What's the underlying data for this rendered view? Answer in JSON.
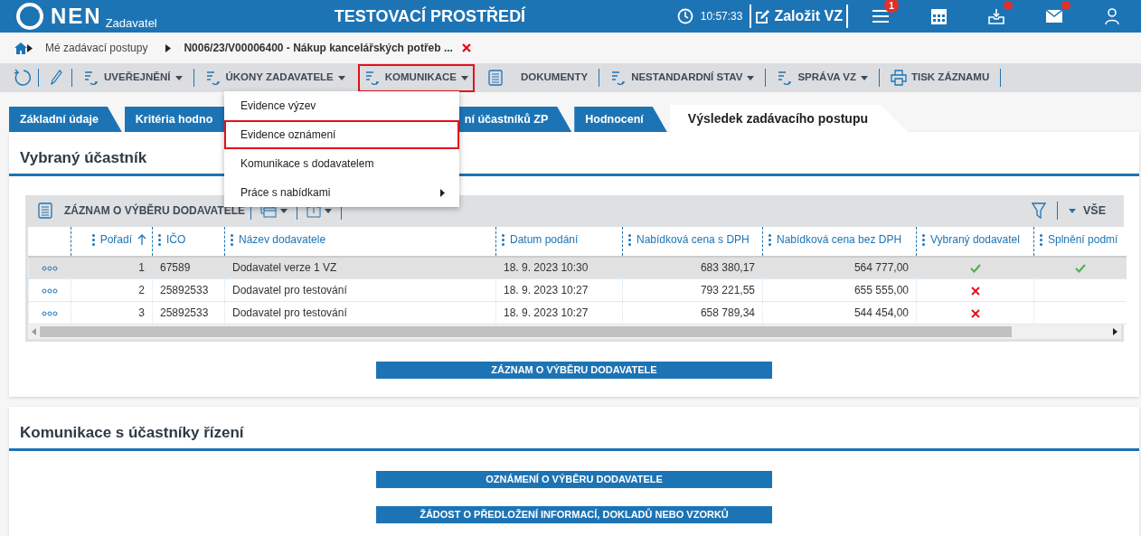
{
  "header": {
    "logo": "NEN",
    "subtitle": "Zadavatel",
    "title": "TESTOVACÍ PROSTŘEDÍ",
    "time": "10:57:33",
    "create_button": "Založit VZ",
    "notifications_badge": "1",
    "inbox_dot": true,
    "mail_dot": true
  },
  "breadcrumb": [
    {
      "kind": "link",
      "label": "Mé zadávací postupy"
    },
    {
      "kind": "current",
      "label": "N006/23/V00006400 - Nákup kancelářských potřeb ..."
    }
  ],
  "toolbar": [
    {
      "kind": "flow",
      "label": "UVEŘEJNĚNÍ",
      "dropdown": true,
      "highlighted": false
    },
    {
      "kind": "flow",
      "label": "ÚKONY ZADAVATELE",
      "dropdown": true,
      "highlighted": false
    },
    {
      "kind": "flow",
      "label": "KOMUNIKACE",
      "dropdown": true,
      "highlighted": true
    },
    {
      "kind": "document",
      "label": "DOKUMENTY",
      "dropdown": false,
      "highlighted": false
    },
    {
      "kind": "flow",
      "label": "NESTANDARDNÍ STAV",
      "dropdown": true,
      "highlighted": false
    },
    {
      "kind": "flow",
      "label": "SPRÁVA VZ",
      "dropdown": true,
      "highlighted": false
    },
    {
      "kind": "print",
      "label": "TISK ZÁZNAMU",
      "dropdown": false,
      "highlighted": false
    }
  ],
  "tabs": [
    {
      "label": "Základní údaje",
      "selected": false
    },
    {
      "label": "Kritéria hodno",
      "selected": false
    },
    {
      "label": "ní účastníků ZP",
      "selected": false
    },
    {
      "label": "Hodnocení",
      "selected": false
    },
    {
      "label": "Výsledek zadávacího postupu",
      "selected": true
    }
  ],
  "menu": {
    "items": [
      {
        "label": "Evidence výzev",
        "selected": false,
        "submenu": false
      },
      {
        "label": "Evidence oznámení",
        "selected": true,
        "submenu": false
      },
      {
        "label": "Komunikace s dodavatelem",
        "selected": false,
        "submenu": false
      },
      {
        "label": "Práce s nabídkami",
        "selected": false,
        "submenu": true
      }
    ]
  },
  "sections": [
    {
      "title": "Vybraný účastník",
      "grid": {
        "title": "ZÁZNAM O VÝBĚRU DODAVATELE",
        "filter_label": "VŠE",
        "columns": [
          {
            "label": "Pořadí",
            "kind": "number",
            "sorted": true
          },
          {
            "label": "IČO",
            "kind": "text",
            "sorted": false
          },
          {
            "label": "Název dodavatele",
            "kind": "text",
            "sorted": false
          },
          {
            "label": "Datum podání",
            "kind": "text",
            "sorted": false
          },
          {
            "label": "Nabídková cena s DPH",
            "kind": "number",
            "sorted": false
          },
          {
            "label": "Nabídková cena bez DPH",
            "kind": "number",
            "sorted": false
          },
          {
            "label": "Vybraný dodavatel",
            "kind": "flag",
            "sorted": false
          },
          {
            "label": "Splnění podmí",
            "kind": "flag",
            "sorted": false
          }
        ],
        "rows": [
          {
            "selected": true,
            "cells": [
              "1",
              "67589",
              "Dodavatel verze 1 VZ",
              "18. 9. 2023 10:30",
              "683 380,17",
              "564 777,00",
              true,
              true
            ]
          },
          {
            "selected": false,
            "cells": [
              "2",
              "25892533",
              "Dodavatel pro testování",
              "18. 9. 2023 10:27",
              "793 221,55",
              "655 555,00",
              false,
              null
            ]
          },
          {
            "selected": false,
            "cells": [
              "3",
              "25892533",
              "Dodavatel pro testování",
              "18. 9. 2023 10:27",
              "658 789,34",
              "544 454,00",
              false,
              null
            ]
          }
        ]
      },
      "buttons": [
        "ZÁZNAM O VÝBĚRU DODAVATELE"
      ]
    },
    {
      "title": "Komunikace s účastníky řízení",
      "buttons": [
        "OZNÁMENÍ O VÝBĚRU DODAVATELE",
        "ŽÁDOST O PŘEDLOŽENÍ INFORMACÍ, DOKLADŮ NEBO VZORKŮ"
      ]
    }
  ]
}
